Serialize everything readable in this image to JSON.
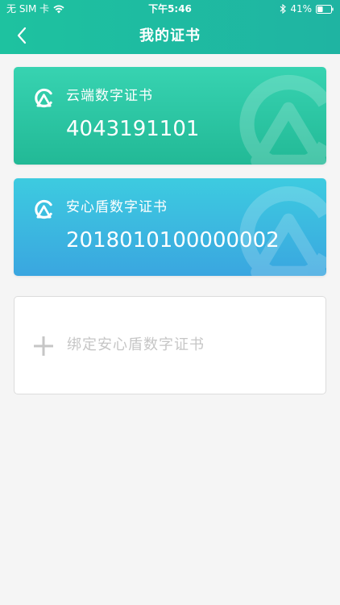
{
  "status_bar": {
    "carrier": "无 SIM 卡",
    "time": "下午5:46",
    "battery": "41%",
    "battery_level": 0.41
  },
  "header": {
    "title": "我的证书",
    "back_icon": "chevron-left-icon"
  },
  "cards": [
    {
      "title": "云端数字证书",
      "number": "4043191101",
      "color": "#2cc7a4",
      "icon": "ca-logo-icon"
    },
    {
      "title": "安心盾数字证书",
      "number": "2018010100000002",
      "color": "#3bb8e0",
      "icon": "ca-logo-icon"
    }
  ],
  "add_card": {
    "label": "绑定安心盾数字证书",
    "icon": "plus-icon"
  },
  "colors": {
    "header": "#1fbca1",
    "background": "#f5f5f5",
    "add_text": "#c6c6c6"
  }
}
